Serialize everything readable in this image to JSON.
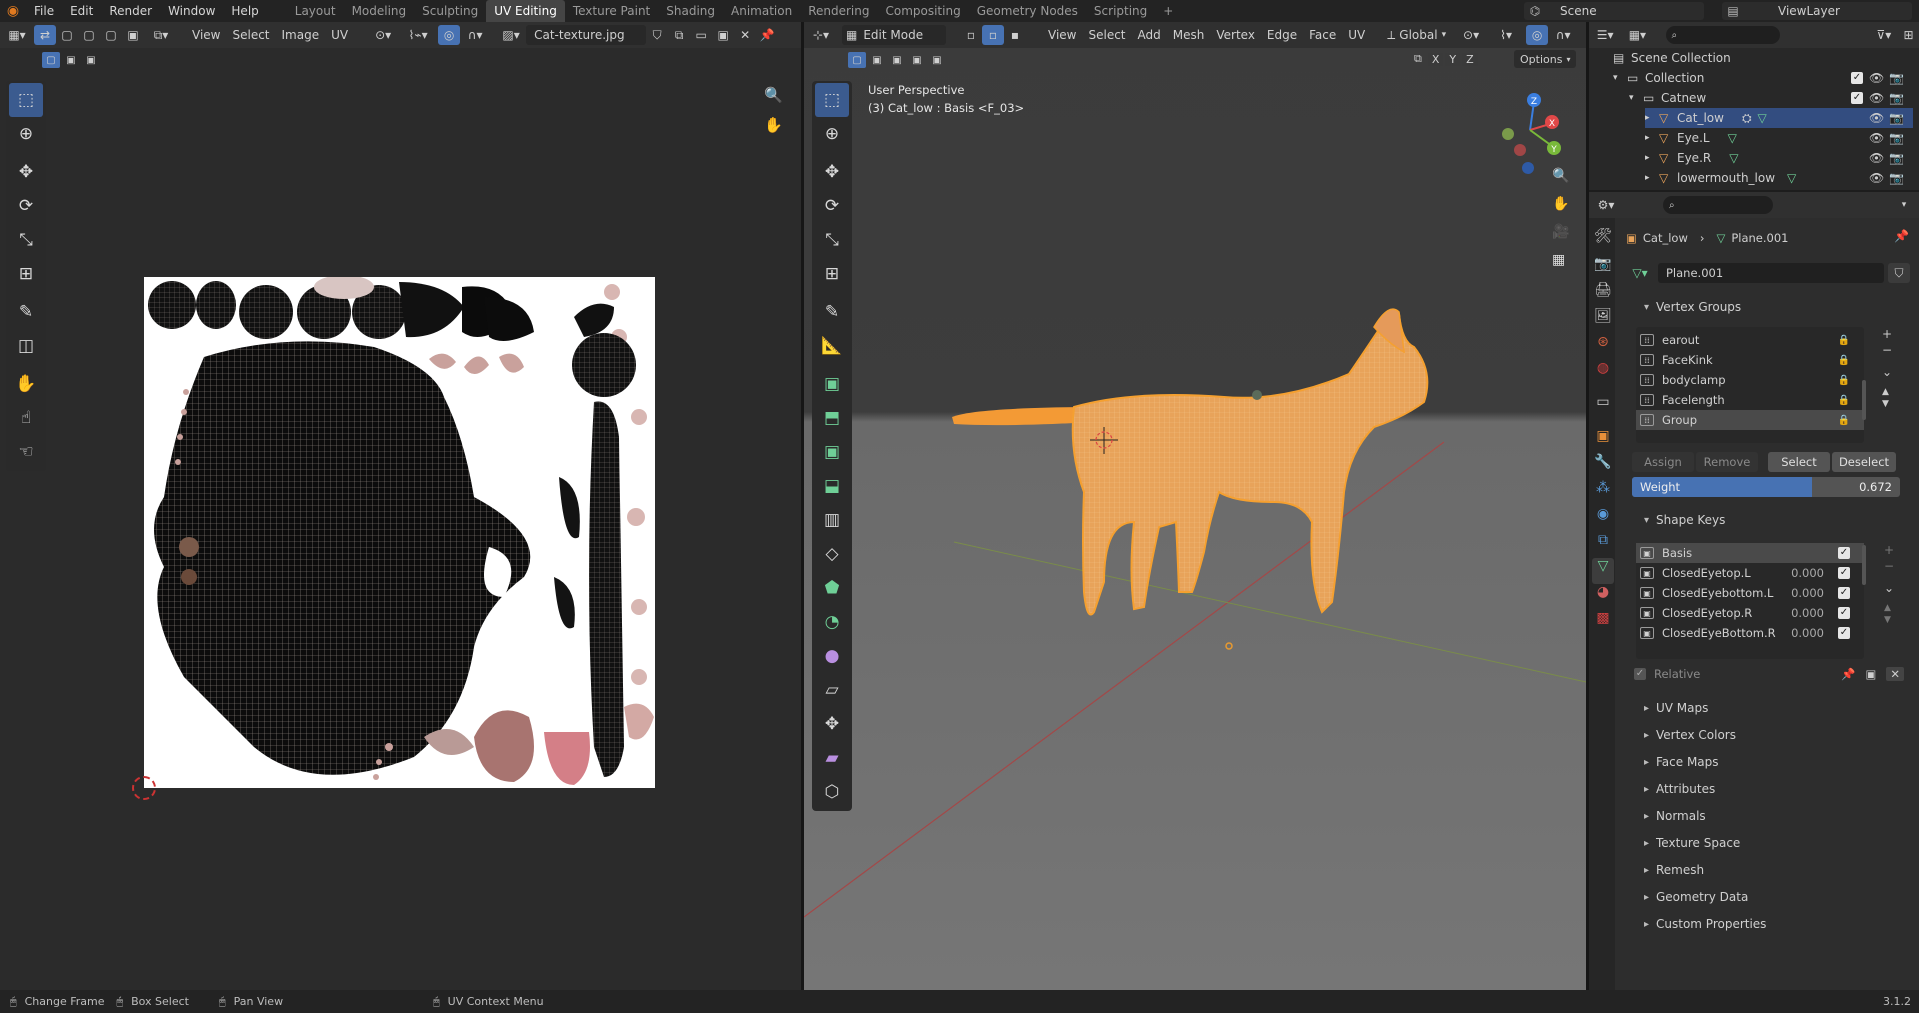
{
  "topbar": {
    "menus": [
      "File",
      "Edit",
      "Render",
      "Window",
      "Help"
    ],
    "workspaces": [
      "Layout",
      "Modeling",
      "Sculpting",
      "UV Editing",
      "Texture Paint",
      "Shading",
      "Animation",
      "Rendering",
      "Compositing",
      "Geometry Nodes",
      "Scripting"
    ],
    "active_workspace": "UV Editing",
    "scene": "Scene",
    "view_layer": "ViewLayer"
  },
  "uv_editor": {
    "menus": [
      "View",
      "Select",
      "Image",
      "UV"
    ],
    "image_name": "Cat-texture.jpg"
  },
  "viewport": {
    "mode": "Edit Mode",
    "menus": [
      "View",
      "Select",
      "Add",
      "Mesh",
      "Vertex",
      "Edge",
      "Face",
      "UV"
    ],
    "transform_orientation": "Global",
    "overlay_label": "User Perspective",
    "object_label": "(3) Cat_low : Basis <F_03>",
    "options_label": "Options",
    "axes": [
      "X",
      "Y",
      "Z"
    ]
  },
  "outliner": {
    "scene_collection": "Scene Collection",
    "collection": "Collection",
    "catnew": "Catnew",
    "objects": [
      "Cat_low",
      "Eye.L",
      "Eye.R",
      "lowermouth_low"
    ]
  },
  "properties": {
    "breadcrumb_object": "Cat_low",
    "breadcrumb_mesh": "Plane.001",
    "mesh_name": "Plane.001",
    "vertex_groups_title": "Vertex Groups",
    "vertex_groups": [
      "earout",
      "FaceKink",
      "bodyclamp",
      "Facelength",
      "Group"
    ],
    "vg_buttons": [
      "Assign",
      "Remove",
      "Select",
      "Deselect"
    ],
    "weight_label": "Weight",
    "weight_value": "0.672",
    "weight_fraction": 0.672,
    "shape_keys_title": "Shape Keys",
    "shape_keys": [
      {
        "name": "Basis",
        "value": ""
      },
      {
        "name": "ClosedEyetop.L",
        "value": "0.000"
      },
      {
        "name": "ClosedEyebottom.L",
        "value": "0.000"
      },
      {
        "name": "ClosedEyetop.R",
        "value": "0.000"
      },
      {
        "name": "ClosedEyeBottom.R",
        "value": "0.000"
      }
    ],
    "relative_label": "Relative",
    "sections": [
      "UV Maps",
      "Vertex Colors",
      "Face Maps",
      "Attributes",
      "Normals",
      "Texture Space",
      "Remesh",
      "Geometry Data",
      "Custom Properties"
    ]
  },
  "statusbar": {
    "items": [
      "Change Frame",
      "Box Select",
      "Pan View",
      "UV Context Menu"
    ],
    "version": "3.1.2"
  },
  "colors": {
    "accent": "#4772b3",
    "selection_orange": "#f5a030",
    "bg": "#1d1d1d"
  }
}
